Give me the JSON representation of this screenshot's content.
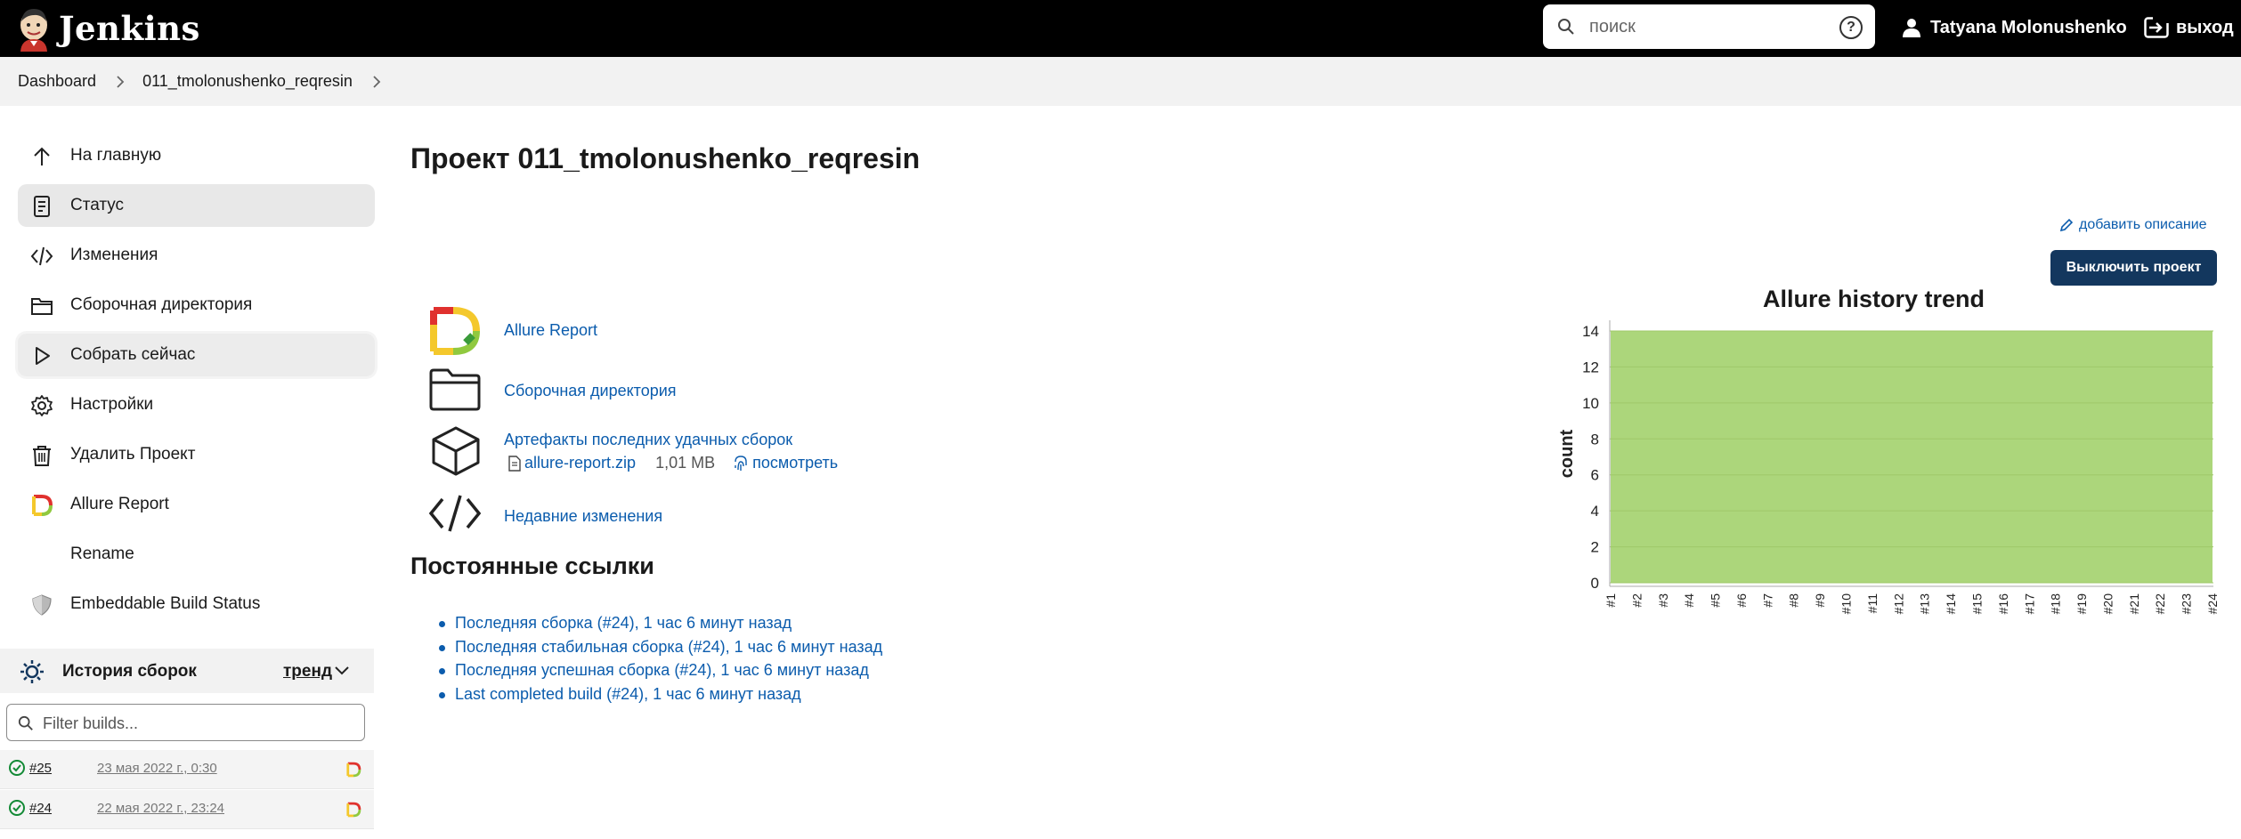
{
  "header": {
    "app_name": "Jenkins",
    "search_placeholder": "поиск",
    "user_name": "Tatyana Molonushenko",
    "logout_label": "выход"
  },
  "breadcrumb": [
    "Dashboard",
    "011_tmolonushenko_reqresin"
  ],
  "sidebar": {
    "items": [
      {
        "label": "На главную",
        "icon": "arrow-up-icon"
      },
      {
        "label": "Статус",
        "icon": "document-icon"
      },
      {
        "label": "Изменения",
        "icon": "code-icon"
      },
      {
        "label": "Сборочная директория",
        "icon": "folder-icon"
      },
      {
        "label": "Собрать сейчас",
        "icon": "play-icon"
      },
      {
        "label": "Настройки",
        "icon": "gear-icon"
      },
      {
        "label": "Удалить Проект",
        "icon": "trash-icon"
      },
      {
        "label": "Allure Report",
        "icon": "allure-icon"
      },
      {
        "label": "Rename",
        "icon": "pencil-icon"
      },
      {
        "label": "Embeddable Build Status",
        "icon": "shield-icon"
      }
    ]
  },
  "build_history": {
    "title": "История сборок",
    "trend_label": "тренд",
    "filter_placeholder": "Filter builds...",
    "builds": [
      {
        "number": "#25",
        "date": "23 мая 2022 г., 0:30"
      },
      {
        "number": "#24",
        "date": "22 мая 2022 г., 23:24"
      }
    ]
  },
  "main": {
    "title": "Проект 011_tmolonushenko_reqresin",
    "add_description": "добавить описание",
    "disable_button": "Выключить проект",
    "links": {
      "allure": "Allure Report",
      "workspace": "Сборочная директория",
      "artifacts": "Артефакты последних удачных сборок",
      "artifact_file": "allure-report.zip",
      "artifact_size": "1,01 MB",
      "artifact_view": "посмотреть",
      "recent_changes": "Недавние изменения"
    },
    "permalinks_title": "Постоянные ссылки",
    "permalinks": [
      "Последняя сборка (#24), 1 час 6 минут назад",
      "Последняя стабильная сборка (#24), 1 час 6 минут назад",
      "Последняя успешная сборка (#24), 1 час 6 минут назад",
      "Last completed build (#24), 1 час 6 минут назад"
    ]
  },
  "chart_data": {
    "type": "area",
    "title": "Allure history trend",
    "ylabel": "count",
    "xlabel": "",
    "ylim": [
      0,
      14
    ],
    "yticks": [
      0,
      2,
      4,
      6,
      8,
      10,
      12,
      14
    ],
    "grid": true,
    "categories": [
      "#1",
      "#2",
      "#3",
      "#4",
      "#5",
      "#6",
      "#7",
      "#8",
      "#9",
      "#10",
      "#11",
      "#12",
      "#13",
      "#14",
      "#15",
      "#16",
      "#17",
      "#18",
      "#19",
      "#20",
      "#21",
      "#22",
      "#23",
      "#24"
    ],
    "series": [
      {
        "values": [
          14,
          14,
          14,
          14,
          14,
          14,
          14,
          14,
          14,
          14,
          14,
          14,
          14,
          14,
          14,
          14,
          14,
          14,
          14,
          14,
          14,
          14,
          14,
          14
        ],
        "color": "#acd67b"
      }
    ]
  },
  "colors": {
    "header_bg": "#000000",
    "link": "#0b5cad",
    "button_bg": "#13375e",
    "chart_fill": "#acd67b",
    "success": "#138a36"
  }
}
